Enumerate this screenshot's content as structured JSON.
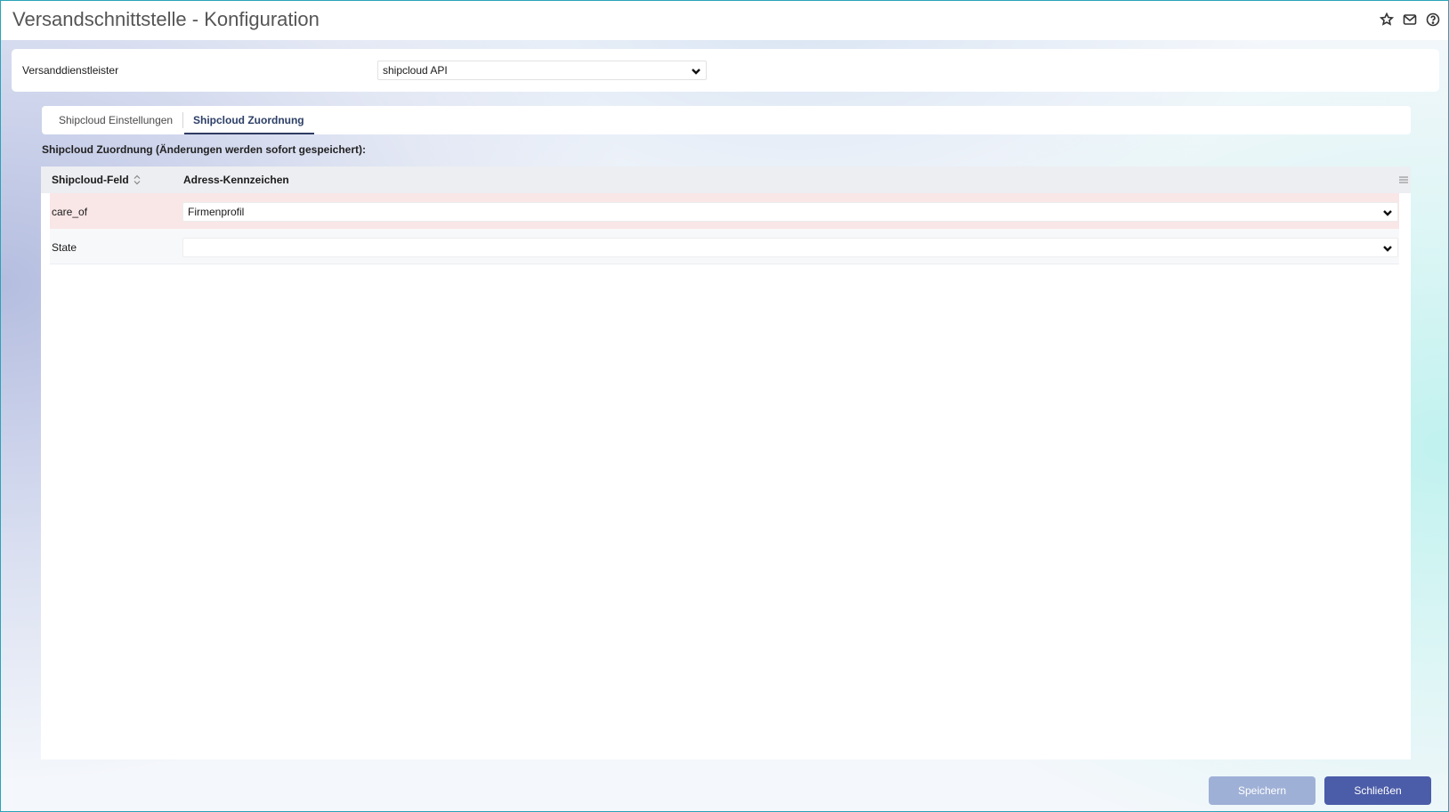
{
  "app": {
    "title": "Versandschnittstelle - Konfiguration"
  },
  "title_icons": [
    "star-icon",
    "mail-icon",
    "help-icon"
  ],
  "provider": {
    "label": "Versanddienstleister",
    "selected": "shipcloud API"
  },
  "tabs": [
    {
      "label": "Shipcloud Einstellungen",
      "active": false
    },
    {
      "label": "Shipcloud Zuordnung",
      "active": true
    }
  ],
  "section": {
    "heading": "Shipcloud Zuordnung (Änderungen werden sofort gespeichert):"
  },
  "grid": {
    "columns": [
      "Shipcloud-Feld",
      "Adress-Kennzeichen"
    ],
    "rows": [
      {
        "field": "care_of",
        "value": "Firmenprofil"
      },
      {
        "field": "State",
        "value": ""
      }
    ]
  },
  "footer": {
    "save_label": "Speichern",
    "close_label": "Schließen"
  },
  "colors": {
    "accent": "#4b5ca8",
    "disabled_button": "#9fb0d6",
    "highlight_row": "#f9e6e6",
    "border": "#2aa3b8"
  }
}
